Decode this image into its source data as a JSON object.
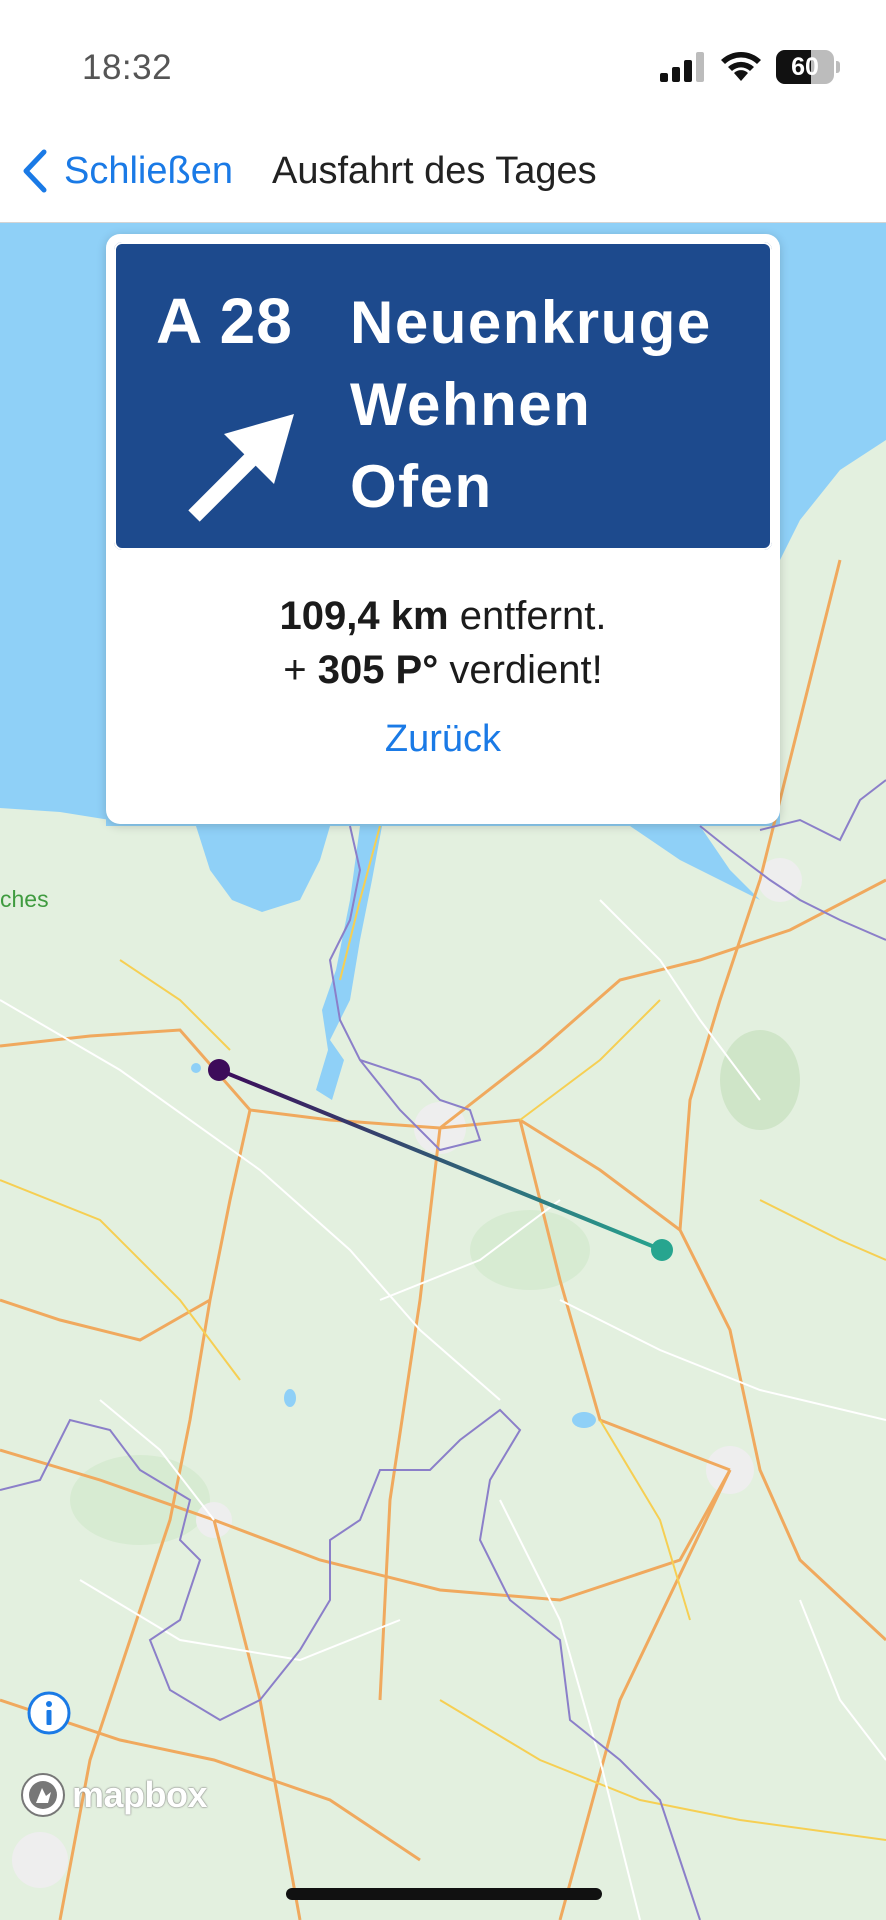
{
  "status_bar": {
    "time": "18:32",
    "battery": "60",
    "battery_level": 0.6,
    "icons": [
      "signal-icon",
      "wifi-icon",
      "battery-icon"
    ]
  },
  "nav": {
    "back_label": "Schließen",
    "title": "Ausfahrt des Tages",
    "back_icon": "chevron-left-icon"
  },
  "exit_sign": {
    "road_number": "A 28",
    "destinations": [
      "Neuenkruge",
      "Wehnen",
      "Ofen"
    ],
    "arrow_icon": "arrow-up-right-icon",
    "background_color": "#1d4a8d"
  },
  "result": {
    "distance_value": "109,4 km",
    "distance_suffix": " entfernt.",
    "points_prefix": "+ ",
    "points_value": "305 P°",
    "points_suffix": " verdient!",
    "back_button": "Zurück"
  },
  "map": {
    "partial_label": "ches",
    "attribution": "mapbox",
    "info_icon": "info-icon",
    "route_colors": [
      "#3d0b5a",
      "#27a58f"
    ],
    "water_color": "#8fd0f7",
    "land_color": "#e3f0df"
  },
  "colors": {
    "accent": "#1a7ae6"
  }
}
